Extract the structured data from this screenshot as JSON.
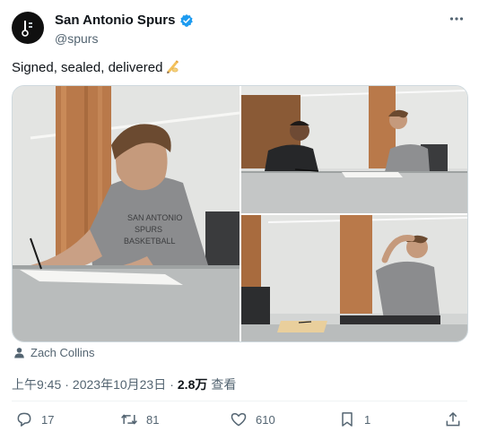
{
  "author": {
    "display_name": "San Antonio Spurs",
    "handle": "@spurs",
    "verified_icon": "verified-badge-icon",
    "avatar_icon": "spurs-logo-icon"
  },
  "tweet": {
    "text": "Signed, sealed, delivered",
    "emoji": "writing-hand-icon"
  },
  "media": {
    "photo_count": 3
  },
  "tagged_user": {
    "icon": "person-icon",
    "name": "Zach Collins"
  },
  "meta": {
    "time": "上午9:45",
    "separator": "·",
    "date": "2023年10月23日",
    "separator2": "·",
    "views_count": "2.8万",
    "views_label": "查看"
  },
  "actions": {
    "reply_count": "17",
    "retweet_count": "81",
    "like_count": "610",
    "bookmark_count": "1"
  },
  "colors": {
    "accent": "#1d9bf0",
    "secondary_text": "#536471",
    "primary_text": "#0f1419"
  }
}
